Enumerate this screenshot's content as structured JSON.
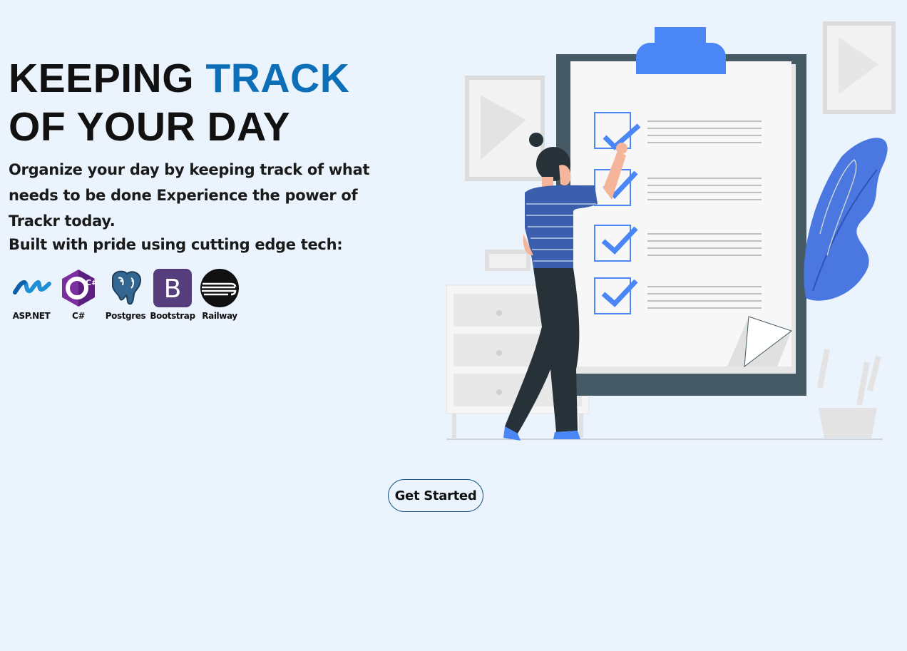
{
  "hero": {
    "title_line1_prefix": "KEEPING ",
    "title_line1_accent": "TRACK",
    "title_line2": "OF YOUR DAY",
    "subtitle": "Organize your day by keeping track of what needs to be done Experience the power of Trackr today.",
    "accent_color": "#0d6fb8"
  },
  "tech": {
    "heading": "Built with pride using cutting edge tech:",
    "items": [
      {
        "label": "ASP.NET",
        "icon": "aspnet-logo-icon"
      },
      {
        "label": "C#",
        "icon": "csharp-logo-icon",
        "logo_text": "C#"
      },
      {
        "label": "Postgres",
        "icon": "postgres-logo-icon"
      },
      {
        "label": "Bootstrap",
        "icon": "bootstrap-logo-icon",
        "logo_text": "B"
      },
      {
        "label": "Railway",
        "icon": "railway-logo-icon"
      }
    ]
  },
  "cta": {
    "label": "Get Started"
  },
  "colors": {
    "background": "#ebf4fd",
    "accent_blue": "#4a86f5",
    "clipboard_frame": "#455a64"
  }
}
